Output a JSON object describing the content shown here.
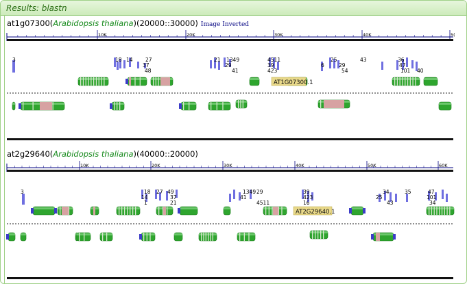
{
  "results_title": "Results: blastn",
  "tracks": [
    {
      "gene": "at1g07300",
      "species": "Arabidopsis thaliana",
      "range": "(20000::30000)",
      "note": "Image Inverted",
      "ticks": [
        "10K",
        "20K",
        "30K",
        "40K",
        "5("
      ],
      "hit_labels": [
        "3",
        "18",
        "14",
        "27",
        "37",
        "48",
        "21",
        "1349",
        "29",
        "41",
        "4511",
        "39",
        "423",
        "6",
        "25",
        "29",
        "54",
        "43",
        "36",
        "47",
        "101",
        "40"
      ],
      "gene_label": "AT1G07300.1"
    },
    {
      "gene": "at2g29640",
      "species": "Arabidopsis thaliana",
      "range": "(40000::20000)",
      "note": "",
      "ticks": [
        "10K",
        "20K",
        "30K",
        "40K",
        "50K",
        "60K"
      ],
      "hit_labels": [
        "3",
        "18",
        "14",
        "1",
        "27",
        "49",
        "37",
        "21",
        "1349",
        "29",
        "41",
        "4511",
        "39",
        "423",
        "16",
        "25",
        "34",
        "43",
        "35",
        "47",
        "101",
        "34"
      ],
      "gene_label": "AT2G29640.1"
    }
  ],
  "colors": {
    "exon_green": "#2ea52e",
    "utr_pink": "#d7a2a2",
    "hit_blue": "#6f6fe0",
    "header_green": "#2a6d14"
  }
}
